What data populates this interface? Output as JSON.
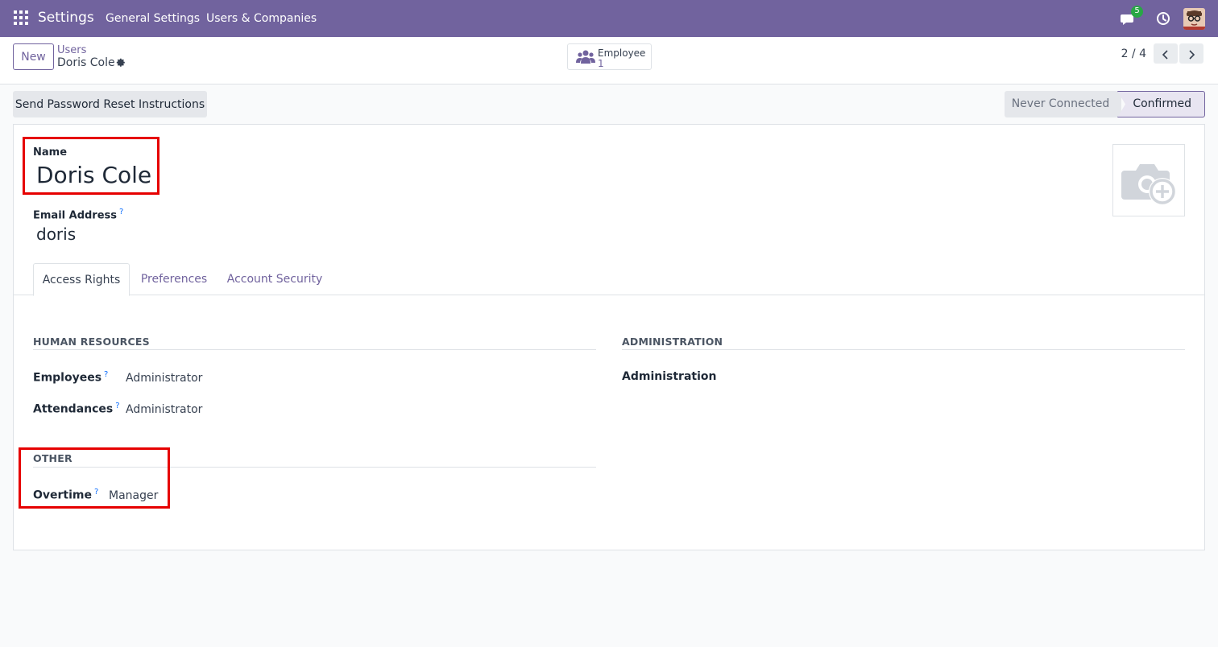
{
  "navbar": {
    "app_title": "Settings",
    "menu": [
      "General Settings",
      "Users & Companies"
    ],
    "chat_badge": "5"
  },
  "control_panel": {
    "new_label": "New",
    "breadcrumb_parent": "Users",
    "breadcrumb_current": "Doris Cole",
    "smart_button": {
      "label": "Employee",
      "value": "1"
    },
    "pager": "2 / 4"
  },
  "statusbar": {
    "reset_button": "Send Password Reset Instructions",
    "stages": [
      "Never Connected",
      "Confirmed"
    ],
    "active_stage": "Confirmed"
  },
  "form": {
    "name_label": "Name",
    "name_value": "Doris Cole",
    "email_label": "Email Address",
    "email_value": "doris",
    "help_mark": "?",
    "tabs": [
      "Access Rights",
      "Preferences",
      "Account Security"
    ],
    "active_tab": "Access Rights",
    "sections": {
      "human_resources": {
        "title": "HUMAN RESOURCES",
        "rows": [
          {
            "label": "Employees",
            "value": "Administrator"
          },
          {
            "label": "Attendances",
            "value": "Administrator"
          }
        ]
      },
      "administration": {
        "title": "ADMINISTRATION",
        "rows": [
          {
            "label": "Administration",
            "value": ""
          }
        ]
      },
      "other": {
        "title": "OTHER",
        "rows": [
          {
            "label": "Overtime",
            "value": "Manager"
          }
        ]
      }
    }
  },
  "colors": {
    "brand": "#71639e",
    "highlight": "#e60000",
    "badge": "#28a745"
  }
}
